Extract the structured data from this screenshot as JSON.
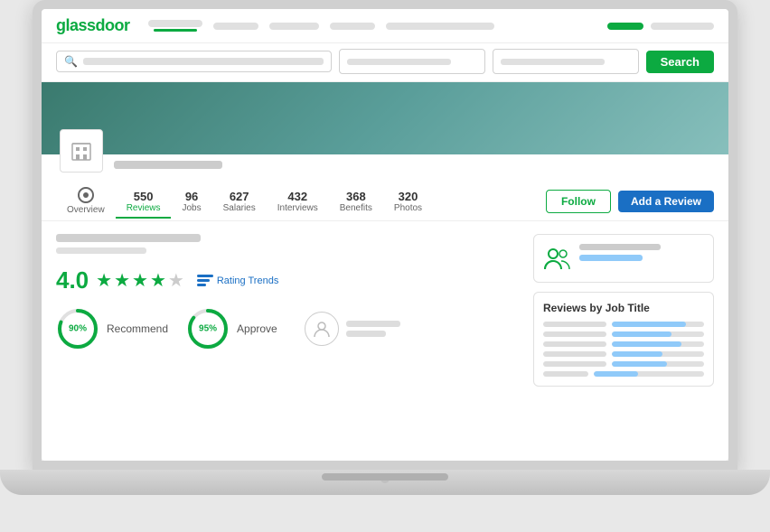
{
  "laptop": {
    "notch_title": "Glassdoor"
  },
  "nav": {
    "logo": "glassdoor",
    "nav_items": [
      {
        "label": "",
        "active": true
      },
      {
        "label": ""
      },
      {
        "label": ""
      },
      {
        "label": ""
      },
      {
        "label": ""
      },
      {
        "label": ""
      },
      {
        "label": ""
      }
    ],
    "active_underline": true
  },
  "search": {
    "main_placeholder": "",
    "location_placeholder": "",
    "company_placeholder": "",
    "button_label": "Search"
  },
  "company": {
    "name_placeholder": "",
    "tabs": [
      {
        "label": "Overview",
        "count": "",
        "active": false
      },
      {
        "label": "Reviews",
        "count": "550",
        "active": true
      },
      {
        "label": "Jobs",
        "count": "96",
        "active": false
      },
      {
        "label": "Salaries",
        "count": "627",
        "active": false
      },
      {
        "label": "Interviews",
        "count": "432",
        "active": false
      },
      {
        "label": "Benefits",
        "count": "368",
        "active": false
      },
      {
        "label": "Photos",
        "count": "320",
        "active": false
      }
    ],
    "follow_label": "Follow",
    "add_review_label": "Add a Review"
  },
  "ratings": {
    "score": "4.0",
    "trend_label": "Rating Trends",
    "recommend_pct": "90%",
    "recommend_label": "Recommend",
    "approve_pct": "95%",
    "approve_label": "Approve"
  },
  "right_panel": {
    "followers_card": {
      "icon": "people-icon"
    },
    "reviews_by_job": {
      "title": "Reviews by Job Title",
      "bars": [
        {
          "width": "80%"
        },
        {
          "width": "65%"
        },
        {
          "width": "75%"
        },
        {
          "width": "55%"
        },
        {
          "width": "60%"
        },
        {
          "width": "40%"
        }
      ]
    }
  }
}
